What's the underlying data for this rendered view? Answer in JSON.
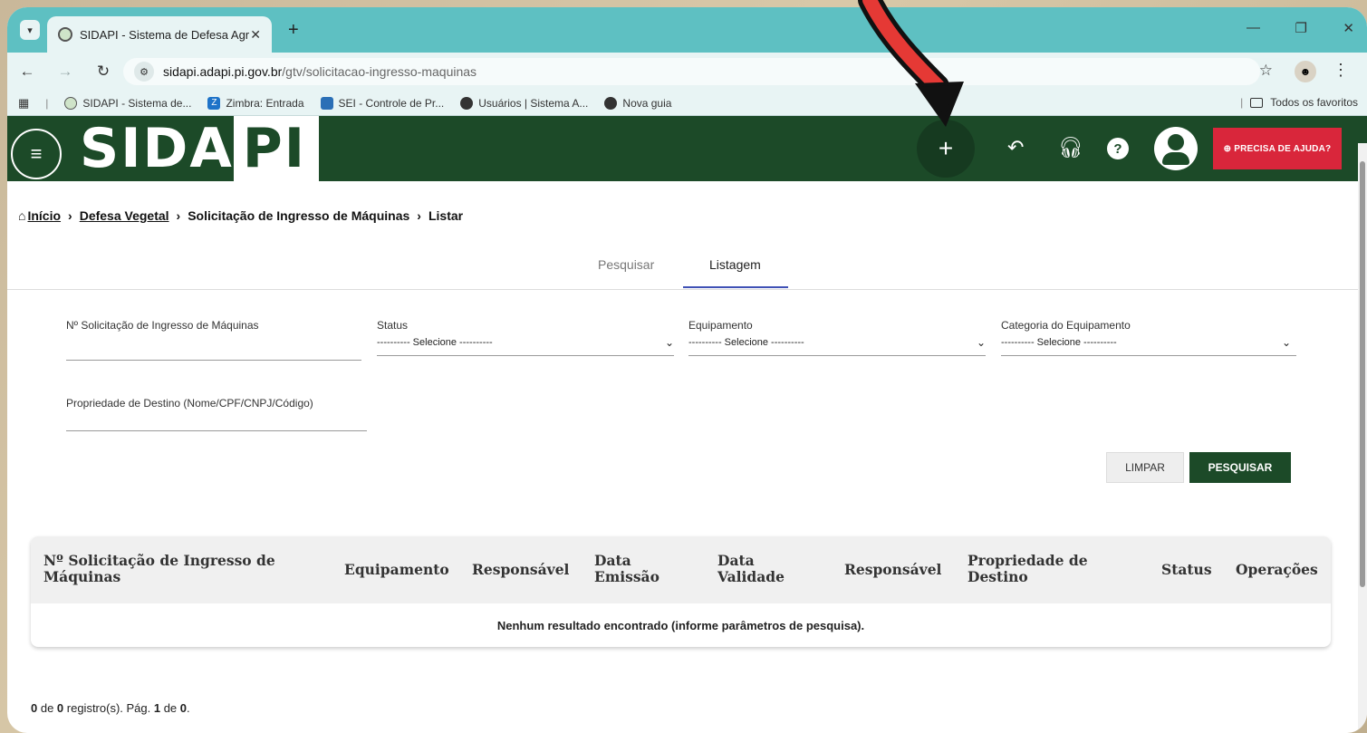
{
  "browser": {
    "tab_title": "SIDAPI - Sistema de Defesa Agr",
    "url_host": "sidapi.adapi.pi.gov.br",
    "url_path": "/gtv/solicitacao-ingresso-maquinas",
    "bookmarks": [
      {
        "label": "SIDAPI - Sistema de..."
      },
      {
        "label": "Zimbra: Entrada"
      },
      {
        "label": "SEI - Controle de Pr..."
      },
      {
        "label": "Usuários | Sistema A..."
      },
      {
        "label": "Nova guia"
      }
    ],
    "all_bookmarks_label": "Todos os favoritos"
  },
  "header": {
    "logo_part1": "SIDA",
    "logo_part2": "PI",
    "help_button": "⊕ PRECISA DE AJUDA?"
  },
  "breadcrumb": {
    "home": "Início",
    "section": "Defesa Vegetal",
    "page": "Solicitação de Ingresso de Máquinas",
    "action": "Listar"
  },
  "tabs": {
    "search": "Pesquisar",
    "list": "Listagem"
  },
  "form": {
    "request_number_label": "Nº Solicitação de Ingresso de Máquinas",
    "request_number_value": "",
    "status_label": "Status",
    "status_value": "---------- Selecione ----------",
    "equipment_label": "Equipamento",
    "equipment_value": "---------- Selecione ----------",
    "category_label": "Categoria do Equipamento",
    "category_value": "---------- Selecione ----------",
    "destination_label": "Propriedade de Destino (Nome/CPF/CNPJ/Código)",
    "destination_value": "",
    "clear_button": "LIMPAR",
    "search_button": "PESQUISAR"
  },
  "table": {
    "columns": [
      "Nº Solicitação de Ingresso de Máquinas",
      "Equipamento",
      "Responsável",
      "Data Emissão",
      "Data Validade",
      "Responsável",
      "Propriedade de Destino",
      "Status",
      "Operações"
    ],
    "empty_message": "Nenhum resultado encontrado (informe parâmetros de pesquisa)."
  },
  "pagination": {
    "shown": "0",
    "of_text": " de ",
    "total": "0",
    "records_text": " registro(s). Pág. ",
    "page": "1",
    "page_of_text": " de ",
    "pages": "0",
    "end": "."
  }
}
